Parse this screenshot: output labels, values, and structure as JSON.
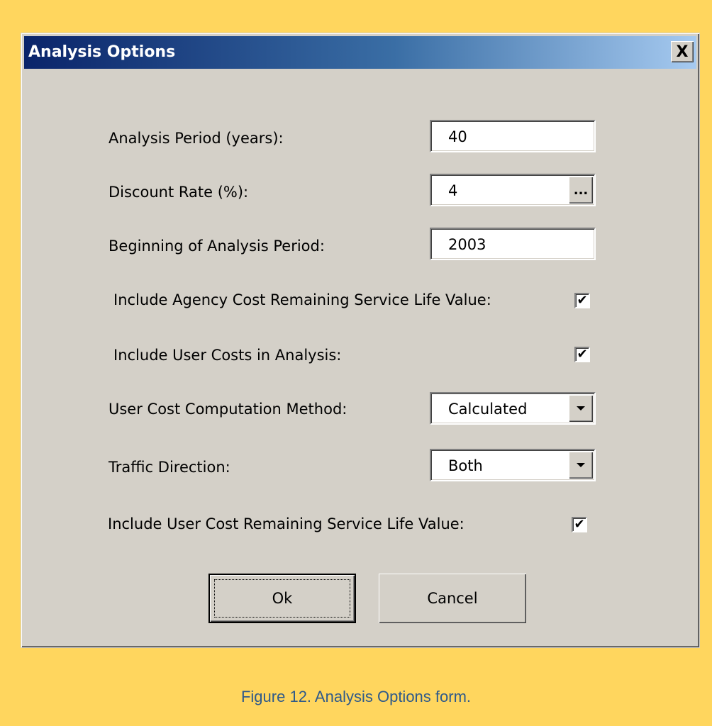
{
  "dialog": {
    "title": "Analysis Options",
    "close_label": "X"
  },
  "fields": {
    "analysis_period_label": "Analysis Period (years):",
    "analysis_period_value": "40",
    "discount_rate_label": "Discount Rate (%):",
    "discount_rate_value": "4",
    "discount_rate_button": "...",
    "beginning_label": "Beginning of Analysis Period:",
    "beginning_value": "2003",
    "agency_cost_label": "Include Agency Cost Remaining Service Life Value:",
    "agency_cost_checked": true,
    "user_costs_label": "Include User Costs in Analysis:",
    "user_costs_checked": true,
    "computation_label": "User Cost Computation Method:",
    "computation_value": "Calculated",
    "traffic_label": "Traffic Direction:",
    "traffic_value": "Both",
    "user_remaining_label": "Include User Cost Remaining Service Life Value:",
    "user_remaining_checked": true,
    "check_glyph": "✔"
  },
  "buttons": {
    "ok": "Ok",
    "cancel": "Cancel"
  },
  "caption": "Figure 12. Analysis Options form.",
  "colors": {
    "page_background": "#ffd65e",
    "dialog_background": "#d4d0c8",
    "titlebar_start": "#0a246a",
    "caption_text": "#2f5a8a"
  }
}
